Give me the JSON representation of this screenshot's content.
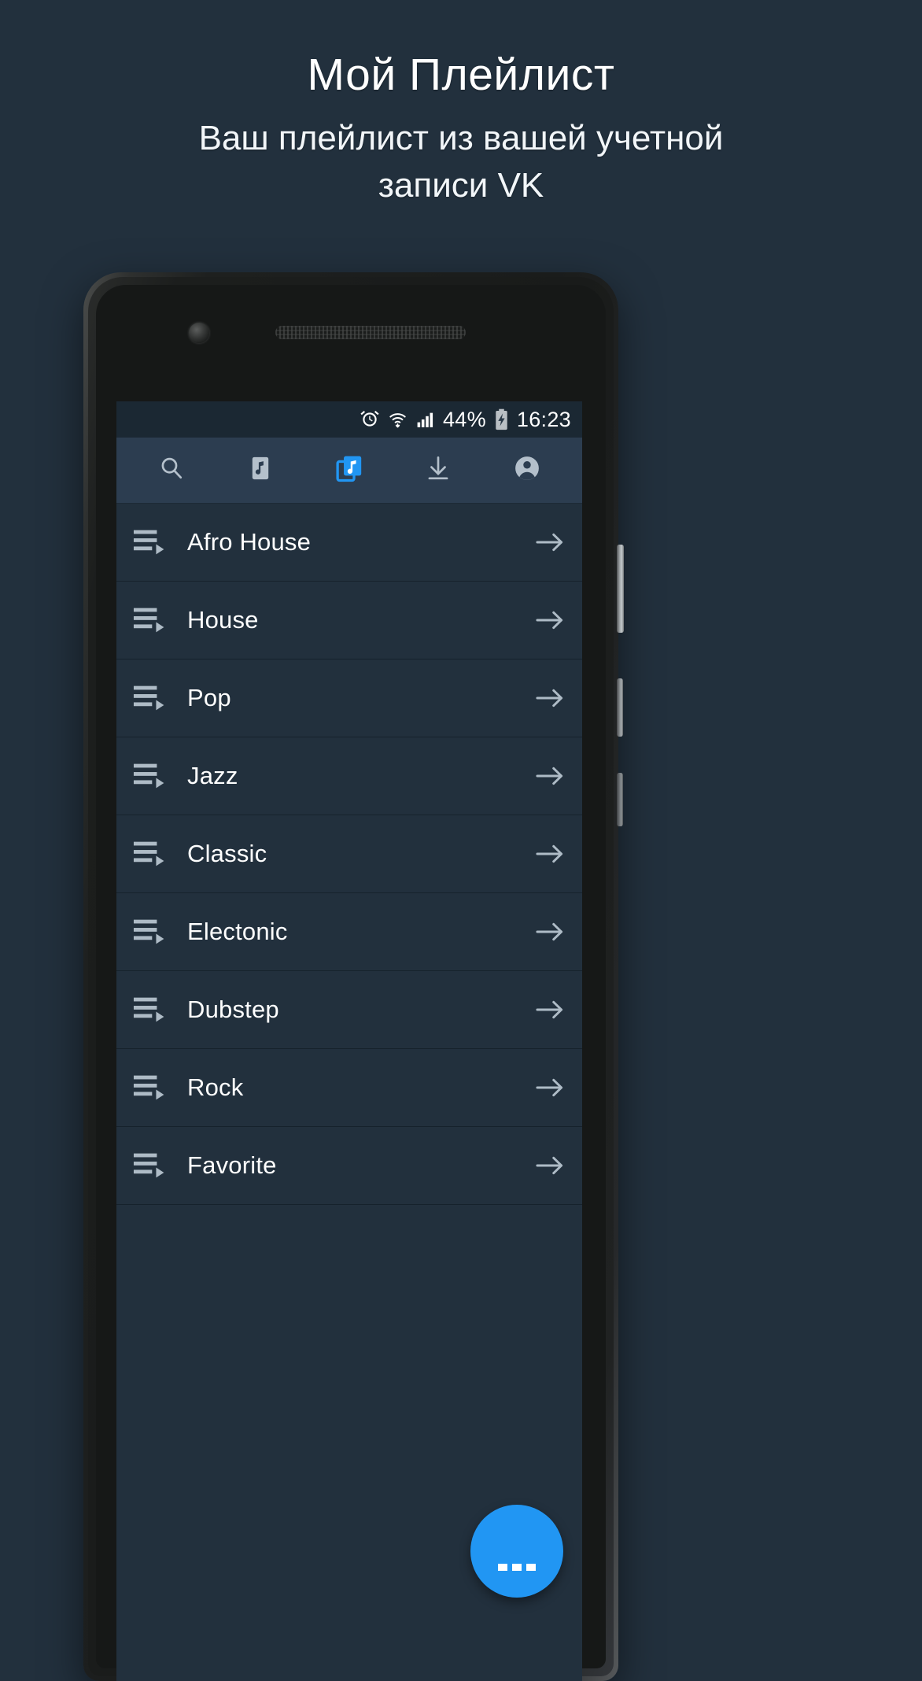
{
  "promo": {
    "title": "Мой Плейлист",
    "subtitle": "Ваш плейлист из вашей учетной записи VK"
  },
  "colors": {
    "page_background": "#22303d",
    "status_bar": "#1b2833",
    "toolbar": "#2c3d50",
    "accent": "#2196f3",
    "divider": "#16222c",
    "icon_inactive": "#aebbc6",
    "text": "#ffffff"
  },
  "phone": {
    "status_bar": {
      "battery_percent": "44%",
      "time": "16:23",
      "icons": [
        "alarm-icon",
        "wifi-icon",
        "signal-icon",
        "battery-charging-icon"
      ]
    },
    "toolbar": {
      "tabs": [
        {
          "name": "search",
          "icon": "search-icon",
          "active": false
        },
        {
          "name": "my-music",
          "icon": "music-note-card-icon",
          "active": false
        },
        {
          "name": "playlists",
          "icon": "music-note-stack-icon",
          "active": true
        },
        {
          "name": "downloads",
          "icon": "download-icon",
          "active": false
        },
        {
          "name": "account",
          "icon": "account-circle-icon",
          "active": false
        }
      ]
    },
    "playlists": [
      {
        "label": "Afro House",
        "icon": "queue-music-icon",
        "arrow": "arrow-right-icon"
      },
      {
        "label": "House",
        "icon": "queue-music-icon",
        "arrow": "arrow-right-icon"
      },
      {
        "label": "Pop",
        "icon": "queue-music-icon",
        "arrow": "arrow-right-icon"
      },
      {
        "label": "Jazz",
        "icon": "queue-music-icon",
        "arrow": "arrow-right-icon"
      },
      {
        "label": "Classic",
        "icon": "queue-music-icon",
        "arrow": "arrow-right-icon"
      },
      {
        "label": "Electonic",
        "icon": "queue-music-icon",
        "arrow": "arrow-right-icon"
      },
      {
        "label": "Dubstep",
        "icon": "queue-music-icon",
        "arrow": "arrow-right-icon"
      },
      {
        "label": "Rock",
        "icon": "queue-music-icon",
        "arrow": "arrow-right-icon"
      },
      {
        "label": "Favorite",
        "icon": "queue-music-icon",
        "arrow": "arrow-right-icon"
      }
    ],
    "fab": {
      "icon": "more-horizontal-icon",
      "label": "..."
    }
  }
}
